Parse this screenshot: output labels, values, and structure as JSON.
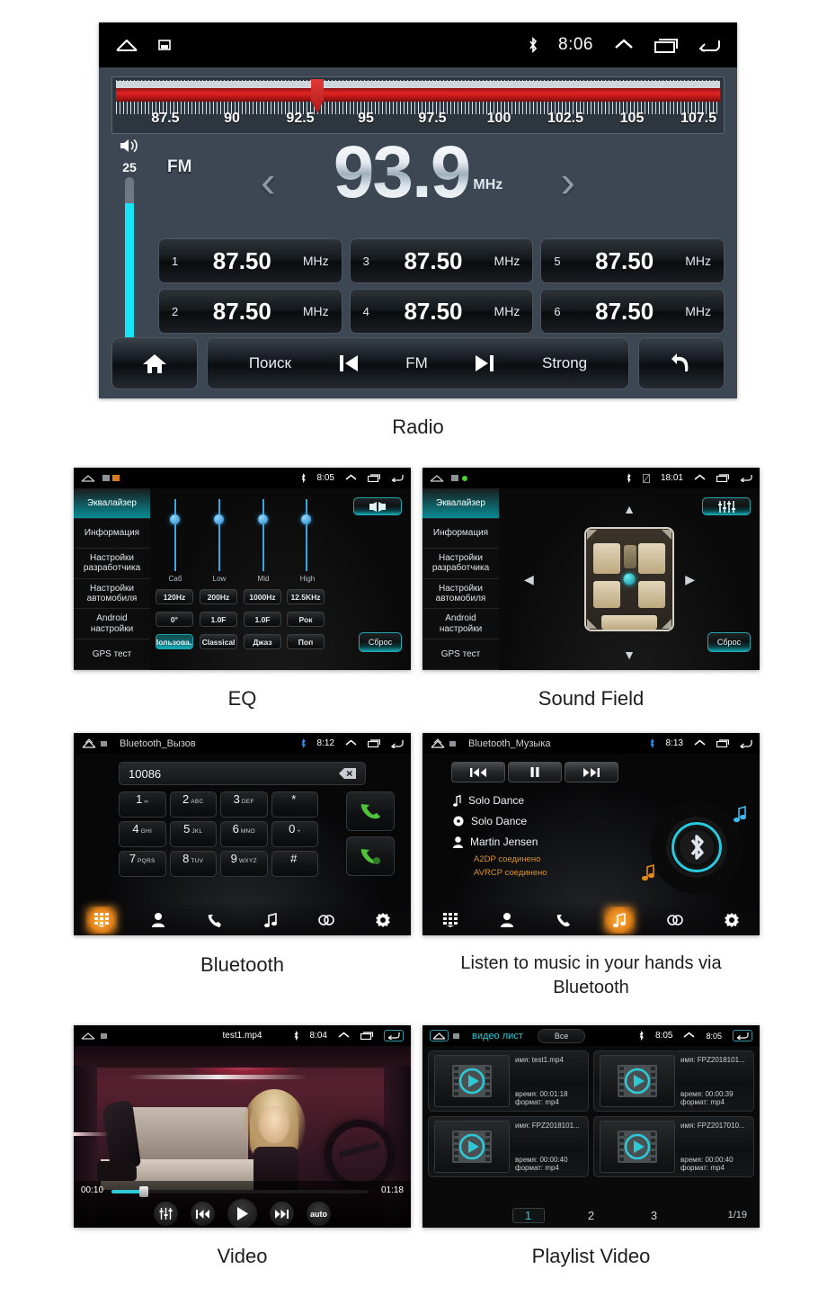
{
  "captions": {
    "radio": "Radio",
    "eq": "EQ",
    "sound_field": "Sound Field",
    "bluetooth": "Bluetooth",
    "bt_music": "Listen to music in your hands via Bluetooth",
    "video": "Video",
    "playlist": "Playlist Video"
  },
  "radio": {
    "statusbar": {
      "time": "8:06",
      "bluetooth_icon": "bluetooth-icon"
    },
    "tuner": {
      "labels": [
        "87.5",
        "90",
        "92.5",
        "95",
        "97.5",
        "100",
        "102.5",
        "105",
        "107.5"
      ],
      "needle_value": "93.9"
    },
    "volume": {
      "value": "25"
    },
    "band": "FM",
    "frequency": "93.9",
    "frequency_unit": "MHz",
    "presets": [
      {
        "index": "1",
        "value": "87.50",
        "unit": "MHz"
      },
      {
        "index": "3",
        "value": "87.50",
        "unit": "MHz"
      },
      {
        "index": "5",
        "value": "87.50",
        "unit": "MHz"
      },
      {
        "index": "2",
        "value": "87.50",
        "unit": "MHz"
      },
      {
        "index": "4",
        "value": "87.50",
        "unit": "MHz"
      },
      {
        "index": "6",
        "value": "87.50",
        "unit": "MHz"
      }
    ],
    "bottom": {
      "search": "Поиск",
      "band": "FM",
      "strong": "Strong"
    }
  },
  "eq": {
    "statusbar": {
      "time": "8:05"
    },
    "sidebar": [
      "Эквалайзер",
      "Информация",
      "Настройки разработчика",
      "Настройки автомобиля",
      "Android настройки",
      "GPS тест"
    ],
    "sliders": [
      {
        "label": "Саб"
      },
      {
        "label": "Low"
      },
      {
        "label": "Mid"
      },
      {
        "label": "High"
      }
    ],
    "row_freq": [
      "120Hz",
      "200Hz",
      "1000Hz",
      "12.5KHz"
    ],
    "row_gain": [
      "0°",
      "1.0F",
      "1.0F",
      "Рок"
    ],
    "row_preset": [
      "Пользова...",
      "Classical",
      "Джаз",
      "Поп"
    ],
    "reset": "Сброс"
  },
  "sound_field": {
    "statusbar": {
      "time": "18:01"
    },
    "sidebar": [
      "Эквалайзер",
      "Информация",
      "Настройки разработчика",
      "Настройки автомобиля",
      "Android настройки",
      "GPS тест"
    ],
    "reset": "Сброс"
  },
  "bluetooth": {
    "statusbar": {
      "time": "8:12"
    },
    "title": "Bluetooth_Вызов",
    "number": "10086",
    "keys": [
      {
        "num": "1",
        "sub": "∞"
      },
      {
        "num": "2",
        "sub": "ABC"
      },
      {
        "num": "3",
        "sub": "DEF"
      },
      {
        "num": "*",
        "sub": ""
      },
      {
        "num": "4",
        "sub": "GHI"
      },
      {
        "num": "5",
        "sub": "JKL"
      },
      {
        "num": "6",
        "sub": "MNO"
      },
      {
        "num": "0",
        "sub": "+"
      },
      {
        "num": "7",
        "sub": "PQRS"
      },
      {
        "num": "8",
        "sub": "TUV"
      },
      {
        "num": "9",
        "sub": "WXYZ"
      },
      {
        "num": "#",
        "sub": ""
      }
    ],
    "nav": [
      "dialpad-icon",
      "contacts-icon",
      "call-log-icon",
      "music-icon",
      "link-icon",
      "settings-icon"
    ]
  },
  "bt_music": {
    "statusbar": {
      "time": "8:13"
    },
    "title": "Bluetooth_Музыка",
    "track": "Solo Dance",
    "album": "Solo Dance",
    "artist": "Martin Jensen",
    "status_a2dp": "A2DP соединено",
    "status_avrcp": "AVRCP соединено"
  },
  "video": {
    "statusbar": {
      "time": "8:04"
    },
    "title": "test1.mp4",
    "elapsed": "00:10",
    "duration": "01:18",
    "auto_label": "auto"
  },
  "playlist": {
    "statusbar": {
      "time": "8:05",
      "extra_time": "8:05"
    },
    "title": "видео лист",
    "filter": "Все",
    "items": [
      {
        "name_label": "имя:",
        "name": "test1.mp4",
        "time_label": "время:",
        "time": "00:01:18",
        "fmt_label": "формат:",
        "fmt": "mp4"
      },
      {
        "name_label": "имя:",
        "name": "FPZ2018101...",
        "time_label": "время:",
        "time": "00:00:39",
        "fmt_label": "формат:",
        "fmt": "mp4"
      },
      {
        "name_label": "имя:",
        "name": "FPZ2018101...",
        "time_label": "время:",
        "time": "00:00:40",
        "fmt_label": "формат:",
        "fmt": "mp4"
      },
      {
        "name_label": "имя:",
        "name": "FPZ2017010...",
        "time_label": "время:",
        "time": "00:00:40",
        "fmt_label": "формат:",
        "fmt": "mp4"
      }
    ],
    "pages": [
      "1",
      "2",
      "3"
    ],
    "page_count": "1/19"
  }
}
